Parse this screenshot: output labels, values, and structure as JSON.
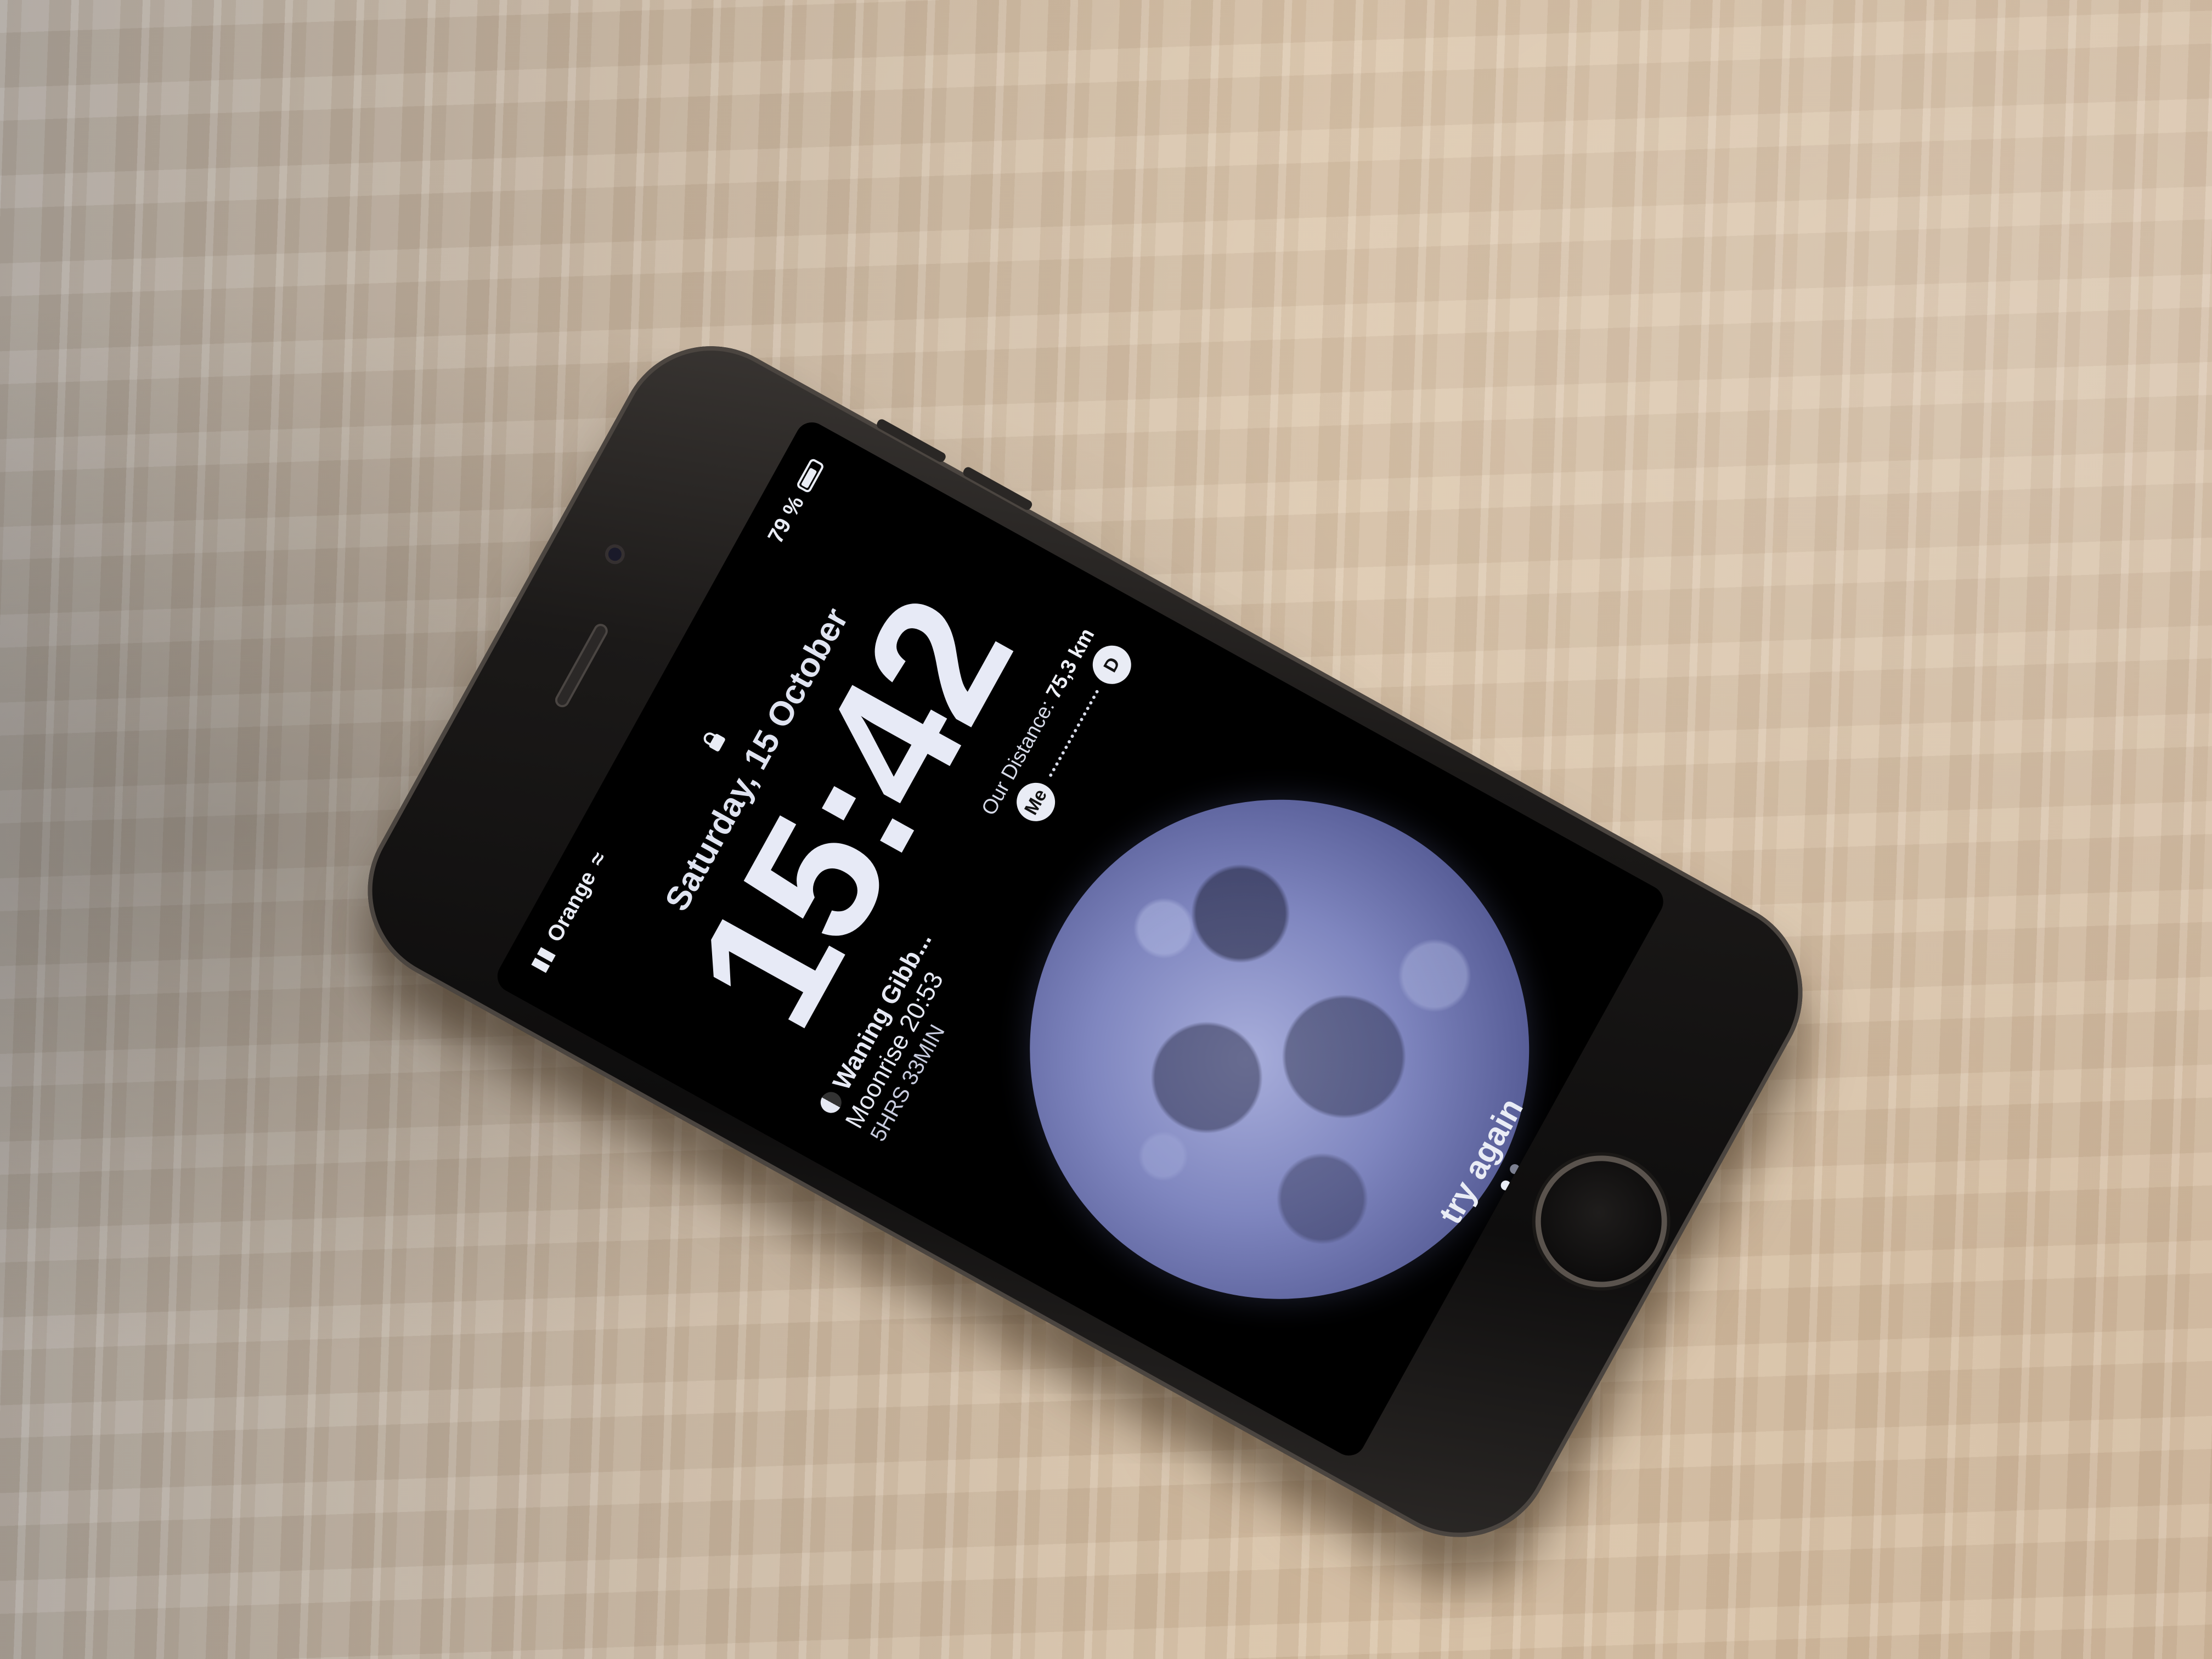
{
  "lockscreen": {
    "status": {
      "carrier": "Orange",
      "battery_text": "79 %",
      "battery_level": 0.79
    },
    "date": "Saturday, 15 October",
    "time": "15:42",
    "moon_widget": {
      "phase": "Waning Gibb...",
      "moonrise": "Moonrise 20:53",
      "countdown": "5HRS 33MIN"
    },
    "distance_widget": {
      "label": "Our Distance:",
      "value": "75,3 km",
      "me_avatar": "Me",
      "other_avatar": "D"
    },
    "hint": "try again",
    "wallpaper": "moon"
  },
  "icons": [
    "lock-icon",
    "wifi-icon",
    "signal-icon",
    "battery-icon",
    "moon-phase-icon",
    "camera-icon"
  ],
  "colors": {
    "table": "#cbb49c",
    "phone_body": "#1b1918",
    "screen": "#000000",
    "moon": "#7f86bf",
    "text": "#e7eaf6"
  }
}
